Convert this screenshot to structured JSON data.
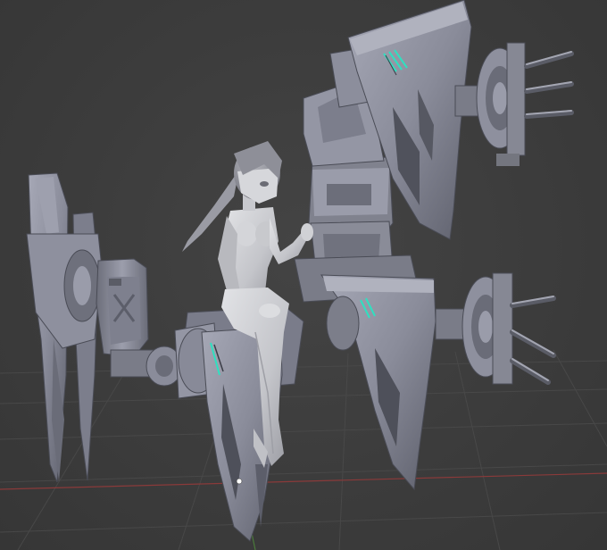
{
  "viewport": {
    "background": "#3c3c3c",
    "grid_color": "#4a4a4a",
    "axis_x_color": "#8a3a3a",
    "axis_y_color": "#4a7a3a",
    "model_color": "#8c8e9c",
    "model_light": "#b4b6c2",
    "model_dark": "#5c5e6a",
    "figure_color": "#c6c8cc",
    "accent_glow": "#2fe0c0"
  },
  "overlay": {
    "watermark": ""
  },
  "origin_marker": {
    "icon": "vertex-dot-icon"
  }
}
